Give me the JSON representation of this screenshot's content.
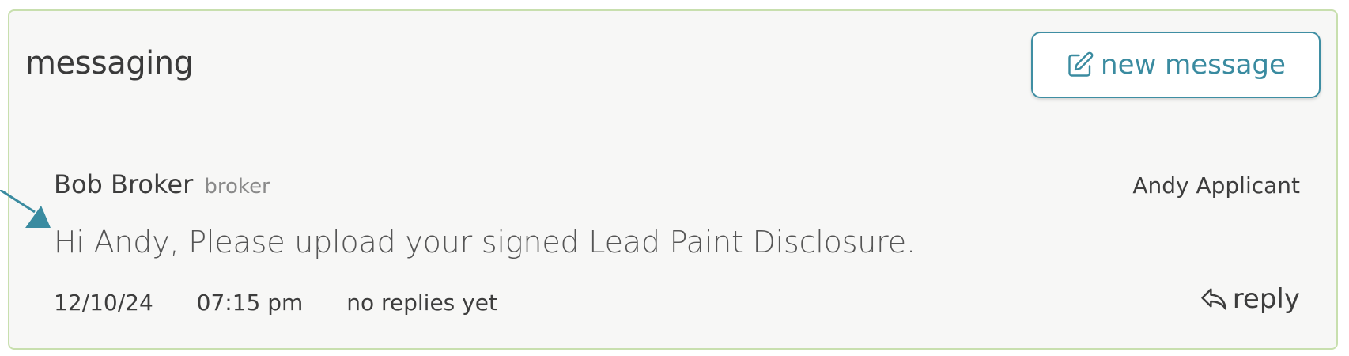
{
  "panel": {
    "title": "messaging",
    "new_message_label": "new message",
    "new_message_icon": "edit-square-icon",
    "accent_color": "#3a8ba0",
    "border_color": "#c8dfae"
  },
  "message": {
    "sender_name": "Bob Broker",
    "sender_role": "broker",
    "recipient": "Andy Applicant",
    "body": "Hi Andy, Please upload your signed Lead Paint Disclosure.",
    "date": "12/10/24",
    "time": "07:15 pm",
    "reply_status": "no replies yet",
    "reply_label": "reply",
    "reply_icon": "reply-arrow-icon"
  },
  "annotation": {
    "pointer_icon": "arrow-pointer-icon",
    "pointer_color": "#3a8ba0"
  }
}
